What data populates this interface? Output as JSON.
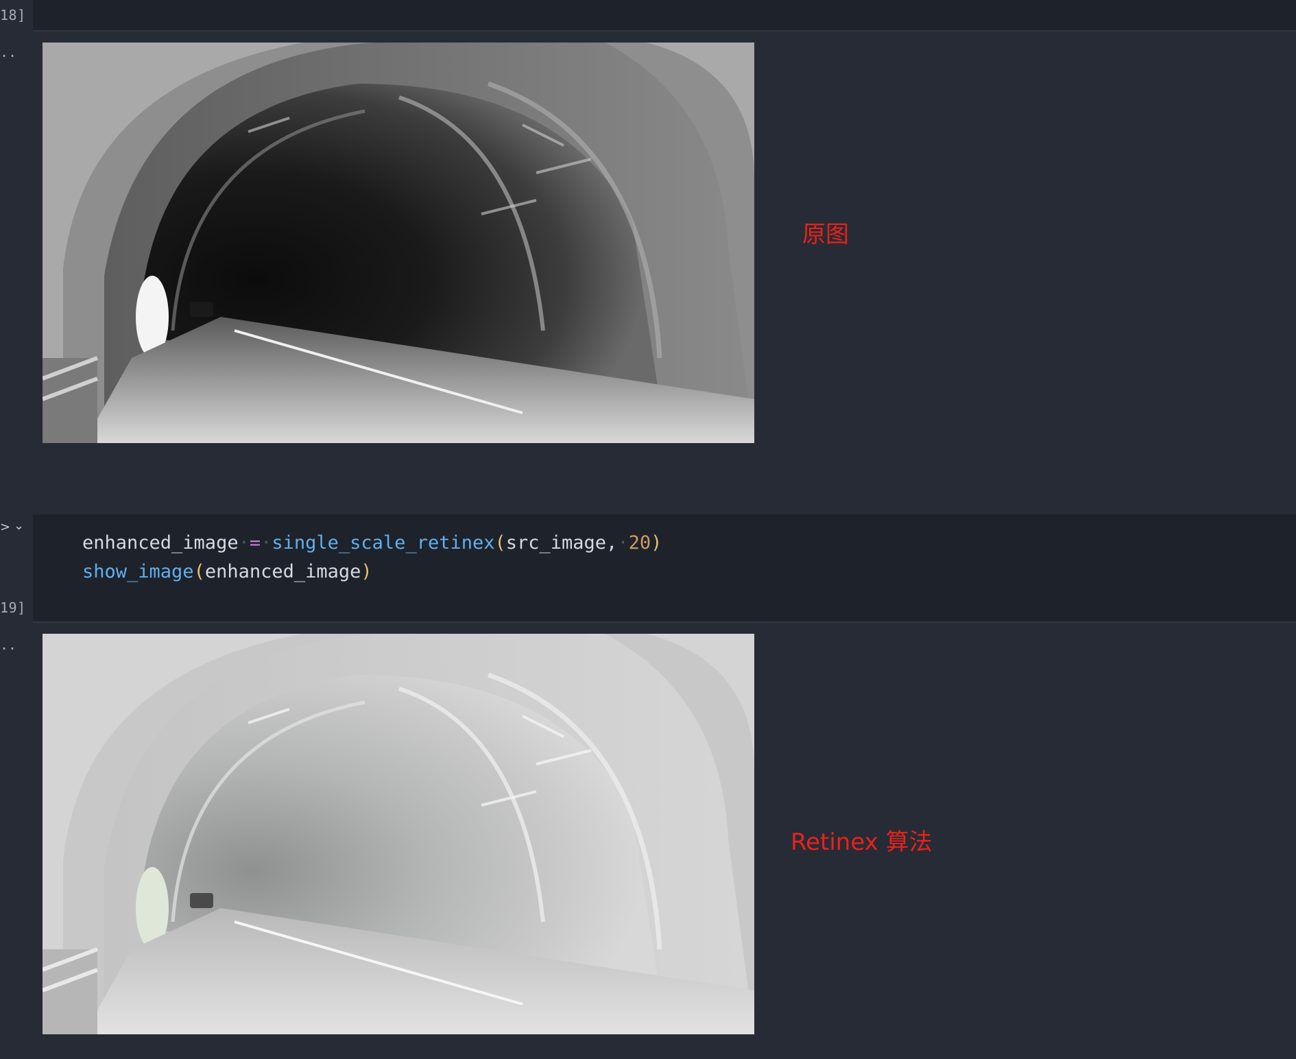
{
  "cells": [
    {
      "execution_label": "18]",
      "output_prompt": "..",
      "annotation": "原图"
    },
    {
      "execution_label": "19]",
      "output_prompt": "..",
      "code": {
        "line1": {
          "var": "enhanced_image",
          "op": "=",
          "fn": "single_scale_retinex",
          "arg1": "src_image,",
          "arg2": "20"
        },
        "line2": {
          "fn": "show_image",
          "arg": "enhanced_image"
        }
      },
      "annotation": "Retinex 算法"
    }
  ],
  "icons": {
    "run": "play-icon",
    "collapse": "chevron-down-icon"
  },
  "colors": {
    "background": "#272b35",
    "code_background": "#1e222a",
    "annotation": "#e8221b",
    "function": "#61afef",
    "operator": "#c678dd",
    "number": "#d19a66",
    "paren": "#e5c07b"
  }
}
